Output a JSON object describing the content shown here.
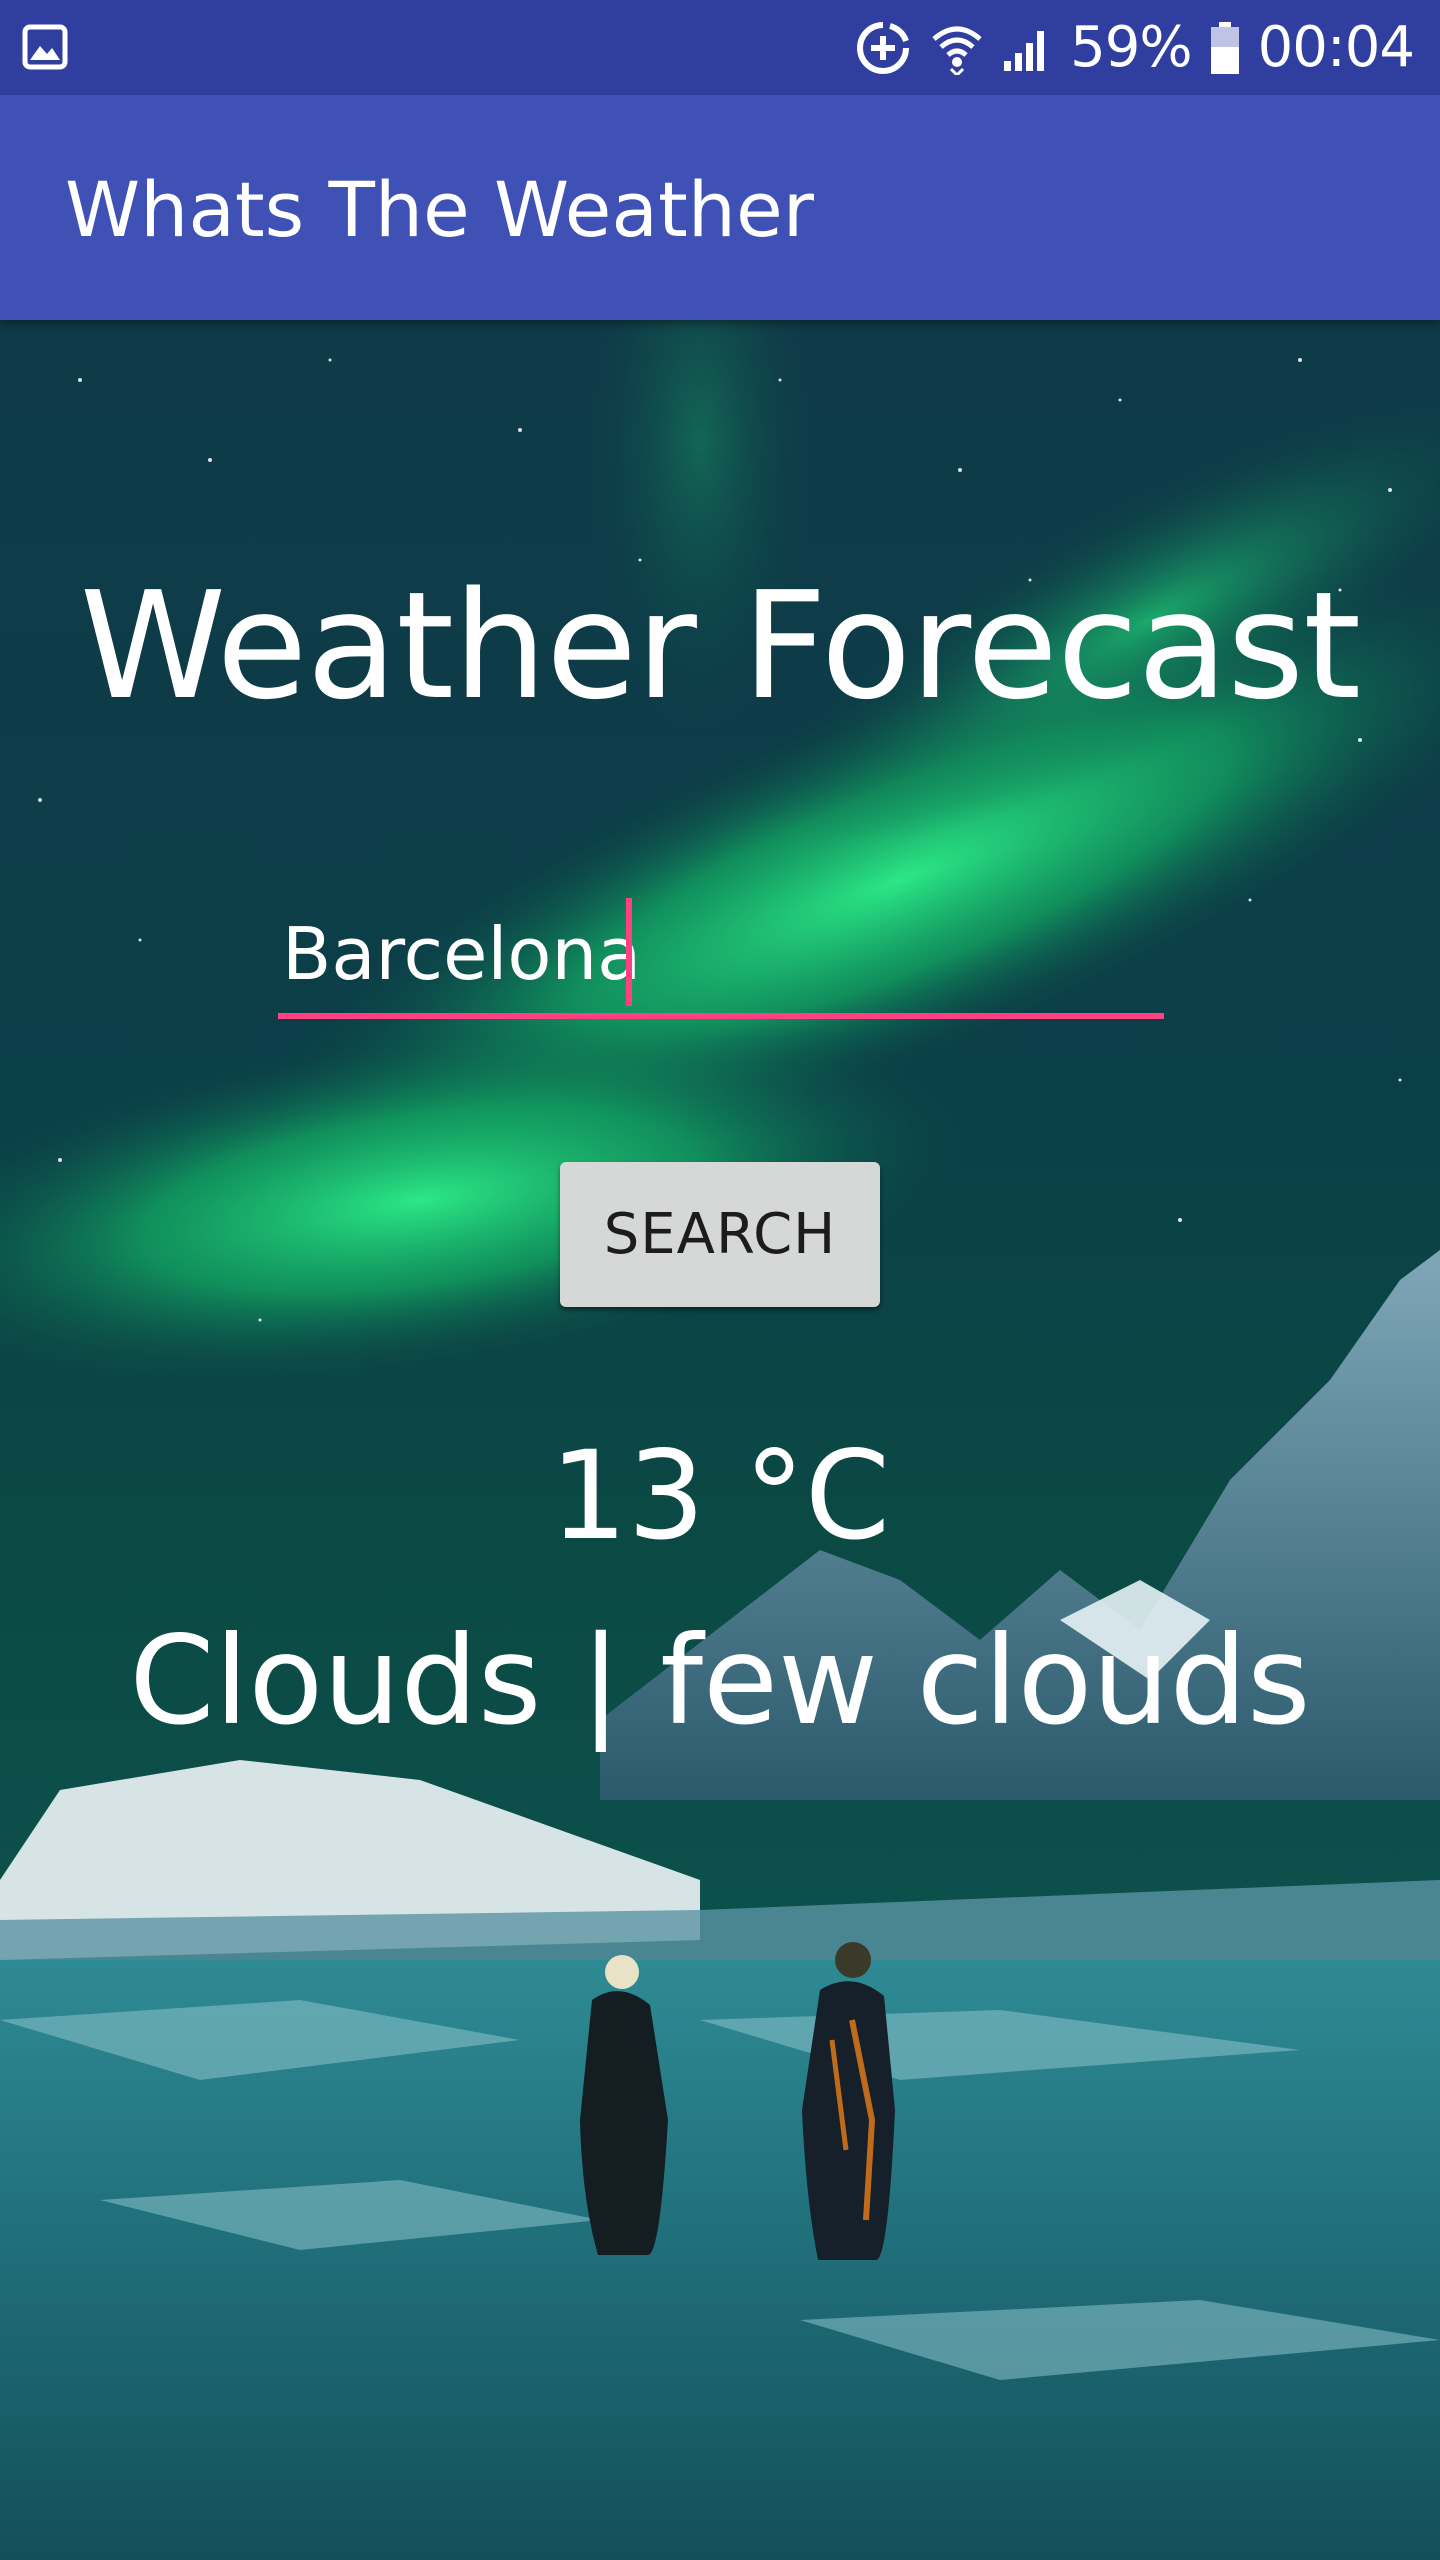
{
  "status_bar": {
    "battery": "59%",
    "time": "00:04",
    "icons": [
      "image-icon",
      "data-saver-icon",
      "wifi-icon",
      "signal-icon",
      "battery-icon"
    ]
  },
  "app_bar": {
    "title": "Whats The Weather"
  },
  "main": {
    "heading": "Weather Forecast",
    "city_input": {
      "value": "Barcelona",
      "placeholder": ""
    },
    "search_button": "SEARCH",
    "temperature": "13 °C",
    "description": "Clouds | few clouds"
  },
  "colors": {
    "status_bar": "#303f9f",
    "app_bar": "#3f51b5",
    "accent": "#ff4081",
    "button": "#d6d7d7"
  }
}
